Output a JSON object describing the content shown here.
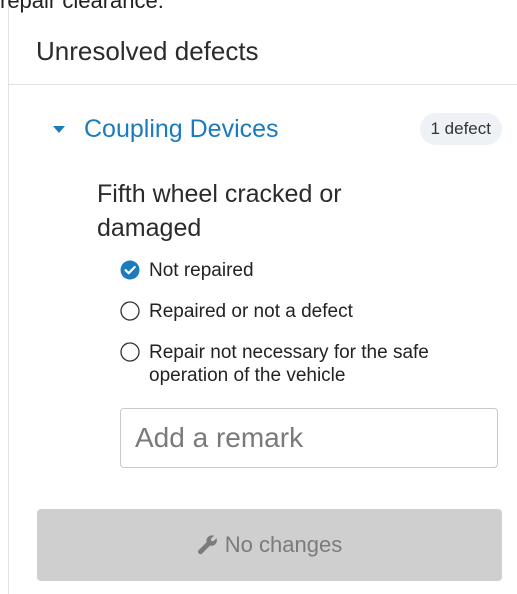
{
  "header": {
    "top_text": "repair clearance."
  },
  "panel": {
    "title": "Unresolved defects"
  },
  "section": {
    "title": "Coupling Devices",
    "badge": "1 defect",
    "expanded": true
  },
  "defect": {
    "name": "Fifth wheel cracked or damaged",
    "options": [
      {
        "label": "Not repaired",
        "selected": true
      },
      {
        "label": "Repaired or not a defect",
        "selected": false
      },
      {
        "label": "Repair not necessary for the safe operation of the vehicle",
        "selected": false
      }
    ],
    "remark_placeholder": "Add a remark",
    "remark_value": ""
  },
  "submit": {
    "label": "No changes",
    "icon": "wrench-icon",
    "disabled": true
  },
  "colors": {
    "accent": "#1a7bbf",
    "badge_bg": "#eef1f5",
    "disabled_bg": "#cfcfcf",
    "disabled_text": "#7b7b7b"
  }
}
